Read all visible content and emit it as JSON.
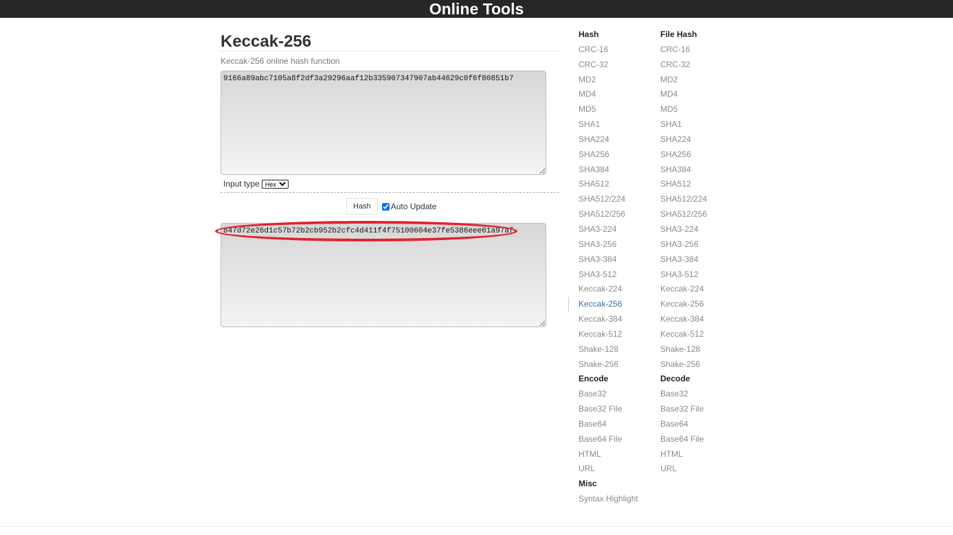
{
  "header": {
    "brand": "Online Tools"
  },
  "main": {
    "title": "Keccak-256",
    "subtitle": "Keccak-256 online hash function",
    "input_value": "9166a89abc7105a8f2df3a29296aaf12b335907347907ab44629c0f6f80851b7",
    "input_type_label": "Input type",
    "input_type_selected": "Hex",
    "hash_button": "Hash",
    "auto_update_label": "Auto Update",
    "auto_update_checked": true,
    "output_value": "847d72e26d1c57b72b2cb952b2cfc4d411f4f75100604e37fe5386eee61a97af",
    "highlight_color": "#e3222f"
  },
  "sidebar": {
    "left": [
      {
        "text": "Hash",
        "kind": "header"
      },
      {
        "text": "CRC-16",
        "kind": "link"
      },
      {
        "text": "CRC-32",
        "kind": "link"
      },
      {
        "text": "MD2",
        "kind": "link"
      },
      {
        "text": "MD4",
        "kind": "link"
      },
      {
        "text": "MD5",
        "kind": "link"
      },
      {
        "text": "SHA1",
        "kind": "link"
      },
      {
        "text": "SHA224",
        "kind": "link"
      },
      {
        "text": "SHA256",
        "kind": "link"
      },
      {
        "text": "SHA384",
        "kind": "link"
      },
      {
        "text": "SHA512",
        "kind": "link"
      },
      {
        "text": "SHA512/224",
        "kind": "link"
      },
      {
        "text": "SHA512/256",
        "kind": "link"
      },
      {
        "text": "SHA3-224",
        "kind": "link"
      },
      {
        "text": "SHA3-256",
        "kind": "link"
      },
      {
        "text": "SHA3-384",
        "kind": "link"
      },
      {
        "text": "SHA3-512",
        "kind": "link"
      },
      {
        "text": "Keccak-224",
        "kind": "link"
      },
      {
        "text": "Keccak-256",
        "kind": "link",
        "active": true
      },
      {
        "text": "Keccak-384",
        "kind": "link"
      },
      {
        "text": "Keccak-512",
        "kind": "link"
      },
      {
        "text": "Shake-128",
        "kind": "link"
      },
      {
        "text": "Shake-256",
        "kind": "link"
      },
      {
        "text": "Encode",
        "kind": "header"
      },
      {
        "text": "Base32",
        "kind": "link"
      },
      {
        "text": "Base32 File",
        "kind": "link"
      },
      {
        "text": "Base64",
        "kind": "link"
      },
      {
        "text": "Base64 File",
        "kind": "link"
      },
      {
        "text": "HTML",
        "kind": "link"
      },
      {
        "text": "URL",
        "kind": "link"
      },
      {
        "text": "Misc",
        "kind": "header"
      },
      {
        "text": "Syntax Highlight",
        "kind": "link"
      }
    ],
    "right": [
      {
        "text": "File Hash",
        "kind": "header"
      },
      {
        "text": "CRC-16",
        "kind": "link"
      },
      {
        "text": "CRC-32",
        "kind": "link"
      },
      {
        "text": "MD2",
        "kind": "link"
      },
      {
        "text": "MD4",
        "kind": "link"
      },
      {
        "text": "MD5",
        "kind": "link"
      },
      {
        "text": "SHA1",
        "kind": "link"
      },
      {
        "text": "SHA224",
        "kind": "link"
      },
      {
        "text": "SHA256",
        "kind": "link"
      },
      {
        "text": "SHA384",
        "kind": "link"
      },
      {
        "text": "SHA512",
        "kind": "link"
      },
      {
        "text": "SHA512/224",
        "kind": "link"
      },
      {
        "text": "SHA512/256",
        "kind": "link"
      },
      {
        "text": "SHA3-224",
        "kind": "link"
      },
      {
        "text": "SHA3-256",
        "kind": "link"
      },
      {
        "text": "SHA3-384",
        "kind": "link"
      },
      {
        "text": "SHA3-512",
        "kind": "link"
      },
      {
        "text": "Keccak-224",
        "kind": "link"
      },
      {
        "text": "Keccak-256",
        "kind": "link"
      },
      {
        "text": "Keccak-384",
        "kind": "link"
      },
      {
        "text": "Keccak-512",
        "kind": "link"
      },
      {
        "text": "Shake-128",
        "kind": "link"
      },
      {
        "text": "Shake-256",
        "kind": "link"
      },
      {
        "text": "Decode",
        "kind": "header"
      },
      {
        "text": "Base32",
        "kind": "link"
      },
      {
        "text": "Base32 File",
        "kind": "link"
      },
      {
        "text": "Base64",
        "kind": "link"
      },
      {
        "text": "Base64 File",
        "kind": "link"
      },
      {
        "text": "HTML",
        "kind": "link"
      },
      {
        "text": "URL",
        "kind": "link"
      }
    ]
  }
}
